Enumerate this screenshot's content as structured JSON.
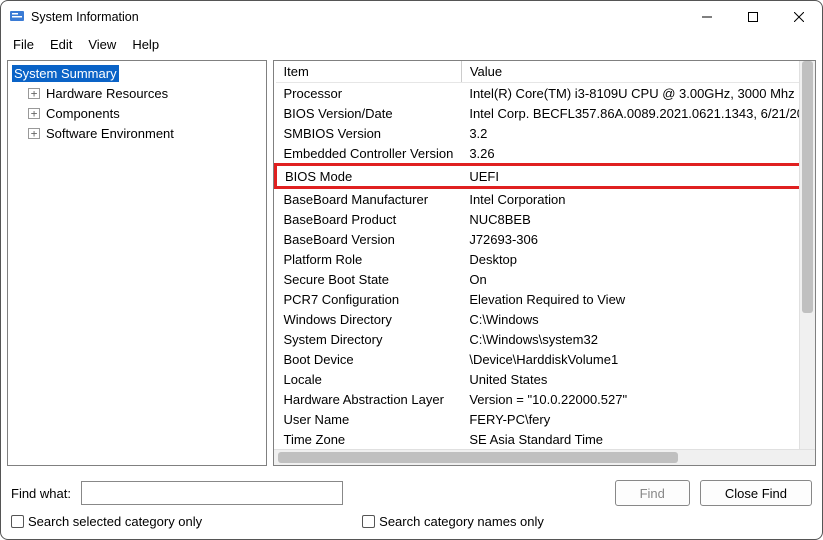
{
  "window": {
    "title": "System Information"
  },
  "menu": {
    "file": "File",
    "edit": "Edit",
    "view": "View",
    "help": "Help"
  },
  "tree": {
    "root": "System Summary",
    "children": [
      "Hardware Resources",
      "Components",
      "Software Environment"
    ]
  },
  "table": {
    "headers": {
      "item": "Item",
      "value": "Value"
    },
    "rows": [
      {
        "item": "Processor",
        "value": "Intel(R) Core(TM) i3-8109U CPU @ 3.00GHz, 3000 Mhz"
      },
      {
        "item": "BIOS Version/Date",
        "value": "Intel Corp. BECFL357.86A.0089.2021.0621.1343, 6/21/20"
      },
      {
        "item": "SMBIOS Version",
        "value": "3.2"
      },
      {
        "item": "Embedded Controller Version",
        "value": "3.26"
      },
      {
        "item": "BIOS Mode",
        "value": "UEFI",
        "highlight": true
      },
      {
        "item": "BaseBoard Manufacturer",
        "value": "Intel Corporation"
      },
      {
        "item": "BaseBoard Product",
        "value": "NUC8BEB"
      },
      {
        "item": "BaseBoard Version",
        "value": "J72693-306"
      },
      {
        "item": "Platform Role",
        "value": "Desktop"
      },
      {
        "item": "Secure Boot State",
        "value": "On"
      },
      {
        "item": "PCR7 Configuration",
        "value": "Elevation Required to View"
      },
      {
        "item": "Windows Directory",
        "value": "C:\\Windows"
      },
      {
        "item": "System Directory",
        "value": "C:\\Windows\\system32"
      },
      {
        "item": "Boot Device",
        "value": "\\Device\\HarddiskVolume1"
      },
      {
        "item": "Locale",
        "value": "United States"
      },
      {
        "item": "Hardware Abstraction Layer",
        "value": "Version = \"10.0.22000.527\""
      },
      {
        "item": "User Name",
        "value": "FERY-PC\\fery"
      },
      {
        "item": "Time Zone",
        "value": "SE Asia Standard Time"
      }
    ]
  },
  "bottom": {
    "find_label": "Find what:",
    "find_value": "",
    "find_button": "Find",
    "close_find_button": "Close Find",
    "check_selected": "Search selected category only",
    "check_names": "Search category names only"
  }
}
